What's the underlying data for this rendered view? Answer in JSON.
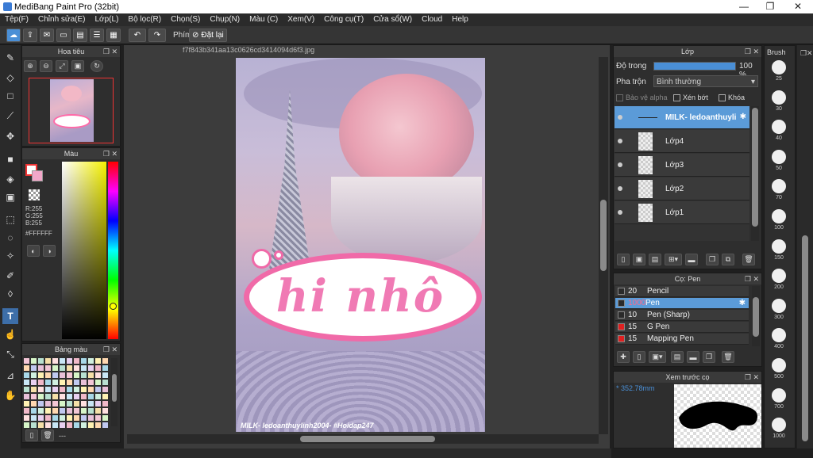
{
  "window": {
    "title": "MediBang Paint Pro (32bit)",
    "minimize": "—",
    "maximize": "❐",
    "close": "✕"
  },
  "menu": [
    "Tệp(F)",
    "Chỉnh sửa(E)",
    "Lớp(L)",
    "Bộ lọc(R)",
    "Chọn(S)",
    "Chụp(N)",
    "Màu (C)",
    "Xem(V)",
    "Công cụ(T)",
    "Cửa sổ(W)",
    "Cloud",
    "Help"
  ],
  "toolbar": {
    "shortcut_label": "Phím",
    "reset_label": "Đặt lại"
  },
  "navigator": {
    "title": "Hoa tiêu"
  },
  "color_panel": {
    "title": "Màu",
    "r": "R:255",
    "g": "G:255",
    "b": "B:255",
    "hex": "#FFFFFF"
  },
  "palette": {
    "title": "Bảng màu",
    "footer": "---"
  },
  "canvas": {
    "filename": "f7f843b341aa13c0626cd3414094d6f3.jpg",
    "watermark": "MILK- ledoanthuylinh2004- #Hoidap247",
    "art_text": "hi nhô"
  },
  "layers": {
    "title": "Lớp",
    "opacity_label": "Độ trong",
    "opacity_value": "100 %",
    "opacity_fraction": 1.0,
    "blend_label": "Pha trộn",
    "blend_value": "Bình thường",
    "protect_alpha": "Bảo vệ alpha",
    "clipping": "Xén bớt",
    "lock": "Khóa",
    "items": [
      {
        "name": "MILK- ledoanthuyli",
        "selected": true
      },
      {
        "name": "Lớp4",
        "selected": false
      },
      {
        "name": "Lớp3",
        "selected": false
      },
      {
        "name": "Lớp2",
        "selected": false
      },
      {
        "name": "Lớp1",
        "selected": false
      }
    ]
  },
  "pens": {
    "title": "Cọ: Pen",
    "items": [
      {
        "size": "20",
        "name": "Pencil",
        "color": "#2a2a2a"
      },
      {
        "size": "1000",
        "name": "Pen",
        "color": "#2a2a2a",
        "selected": true
      },
      {
        "size": "10",
        "name": "Pen (Sharp)",
        "color": "#2a2a2a"
      },
      {
        "size": "15",
        "name": "G Pen",
        "color": "#e02020"
      },
      {
        "size": "15",
        "name": "Mapping Pen",
        "color": "#e02020"
      }
    ]
  },
  "preview": {
    "title": "Xem trước cọ",
    "size": "352.78mm"
  },
  "brush_sizes": {
    "title": "Brush",
    "items": [
      "25",
      "30",
      "40",
      "50",
      "70",
      "100",
      "150",
      "200",
      "300",
      "400",
      "500",
      "700",
      "1000"
    ]
  },
  "colors": {
    "accent": "#4a8fd6",
    "selected_row": "#5b9bd8",
    "panel": "#2e2e2e"
  }
}
